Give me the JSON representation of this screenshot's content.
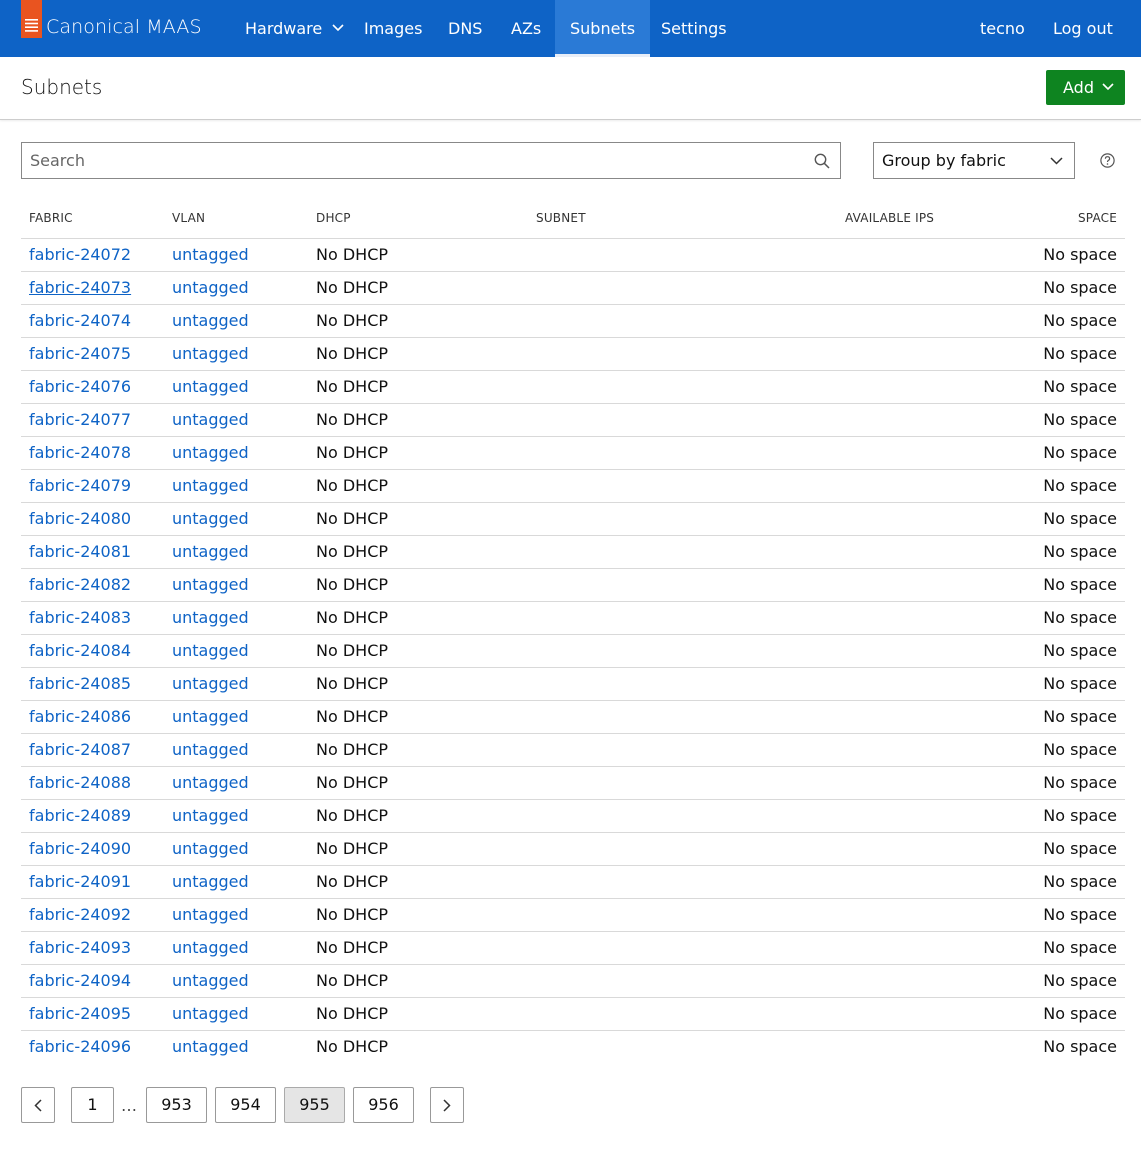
{
  "nav": {
    "brand": "Canonical MAAS",
    "items": [
      {
        "label": "Hardware"
      },
      {
        "label": "Images"
      },
      {
        "label": "DNS"
      },
      {
        "label": "AZs"
      },
      {
        "label": "Subnets"
      },
      {
        "label": "Settings"
      }
    ],
    "user": "tecno",
    "logout": "Log out"
  },
  "header": {
    "title": "Subnets",
    "add_label": "Add"
  },
  "controls": {
    "search_placeholder": "Search",
    "group_by": "Group by fabric"
  },
  "table": {
    "columns": [
      "FABRIC",
      "VLAN",
      "DHCP",
      "SUBNET",
      "AVAILABLE IPS",
      "SPACE"
    ],
    "rows": [
      {
        "fabric": "fabric-24072",
        "vlan": "untagged",
        "dhcp": "No DHCP",
        "space": "No space"
      },
      {
        "fabric": "fabric-24073",
        "vlan": "untagged",
        "dhcp": "No DHCP",
        "space": "No space"
      },
      {
        "fabric": "fabric-24074",
        "vlan": "untagged",
        "dhcp": "No DHCP",
        "space": "No space"
      },
      {
        "fabric": "fabric-24075",
        "vlan": "untagged",
        "dhcp": "No DHCP",
        "space": "No space"
      },
      {
        "fabric": "fabric-24076",
        "vlan": "untagged",
        "dhcp": "No DHCP",
        "space": "No space"
      },
      {
        "fabric": "fabric-24077",
        "vlan": "untagged",
        "dhcp": "No DHCP",
        "space": "No space"
      },
      {
        "fabric": "fabric-24078",
        "vlan": "untagged",
        "dhcp": "No DHCP",
        "space": "No space"
      },
      {
        "fabric": "fabric-24079",
        "vlan": "untagged",
        "dhcp": "No DHCP",
        "space": "No space"
      },
      {
        "fabric": "fabric-24080",
        "vlan": "untagged",
        "dhcp": "No DHCP",
        "space": "No space"
      },
      {
        "fabric": "fabric-24081",
        "vlan": "untagged",
        "dhcp": "No DHCP",
        "space": "No space"
      },
      {
        "fabric": "fabric-24082",
        "vlan": "untagged",
        "dhcp": "No DHCP",
        "space": "No space"
      },
      {
        "fabric": "fabric-24083",
        "vlan": "untagged",
        "dhcp": "No DHCP",
        "space": "No space"
      },
      {
        "fabric": "fabric-24084",
        "vlan": "untagged",
        "dhcp": "No DHCP",
        "space": "No space"
      },
      {
        "fabric": "fabric-24085",
        "vlan": "untagged",
        "dhcp": "No DHCP",
        "space": "No space"
      },
      {
        "fabric": "fabric-24086",
        "vlan": "untagged",
        "dhcp": "No DHCP",
        "space": "No space"
      },
      {
        "fabric": "fabric-24087",
        "vlan": "untagged",
        "dhcp": "No DHCP",
        "space": "No space"
      },
      {
        "fabric": "fabric-24088",
        "vlan": "untagged",
        "dhcp": "No DHCP",
        "space": "No space"
      },
      {
        "fabric": "fabric-24089",
        "vlan": "untagged",
        "dhcp": "No DHCP",
        "space": "No space"
      },
      {
        "fabric": "fabric-24090",
        "vlan": "untagged",
        "dhcp": "No DHCP",
        "space": "No space"
      },
      {
        "fabric": "fabric-24091",
        "vlan": "untagged",
        "dhcp": "No DHCP",
        "space": "No space"
      },
      {
        "fabric": "fabric-24092",
        "vlan": "untagged",
        "dhcp": "No DHCP",
        "space": "No space"
      },
      {
        "fabric": "fabric-24093",
        "vlan": "untagged",
        "dhcp": "No DHCP",
        "space": "No space"
      },
      {
        "fabric": "fabric-24094",
        "vlan": "untagged",
        "dhcp": "No DHCP",
        "space": "No space"
      },
      {
        "fabric": "fabric-24095",
        "vlan": "untagged",
        "dhcp": "No DHCP",
        "space": "No space"
      },
      {
        "fabric": "fabric-24096",
        "vlan": "untagged",
        "dhcp": "No DHCP",
        "space": "No space"
      }
    ]
  },
  "pagination": {
    "first": "1",
    "ellipsis": "…",
    "pages": [
      "953",
      "954",
      "955",
      "956"
    ],
    "current": "955"
  },
  "colors": {
    "navbar": "#0e63c6",
    "brand_tag": "#e95420",
    "add_button": "#0e8420",
    "link": "#0e63c6"
  }
}
